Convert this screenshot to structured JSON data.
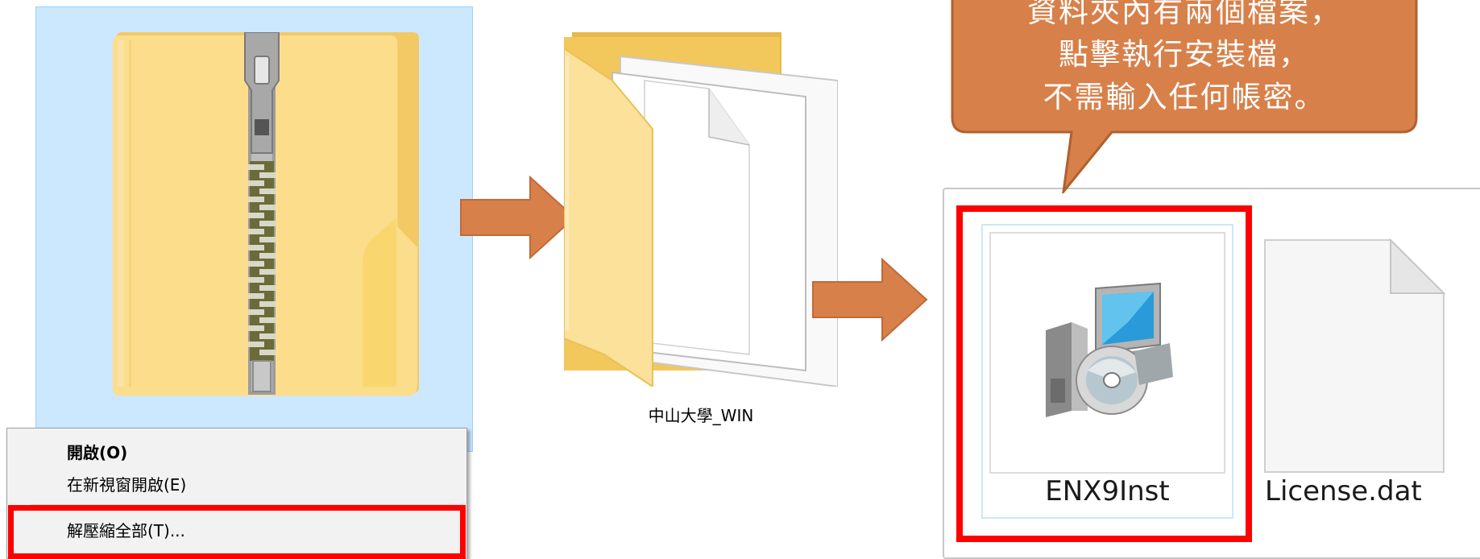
{
  "context_menu": {
    "items": [
      {
        "label": "開啟(O)"
      },
      {
        "label": "在新視窗開啟(E)"
      },
      {
        "label": "解壓縮全部(T)..."
      }
    ]
  },
  "folder": {
    "label": "中山大學_WIN"
  },
  "files": [
    {
      "label": "ENX9Inst",
      "icon": "installer-icon"
    },
    {
      "label": "License.dat",
      "icon": "blank-file-icon"
    }
  ],
  "callout": {
    "lines": [
      "資料夾內有兩個檔案，",
      "點擊執行安裝檔，",
      "不需輸入任何帳密。"
    ],
    "color": "#d8804a"
  },
  "colors": {
    "arrow": "#d8804a",
    "highlight": "#ff0000",
    "selection": "#cce8ff"
  }
}
